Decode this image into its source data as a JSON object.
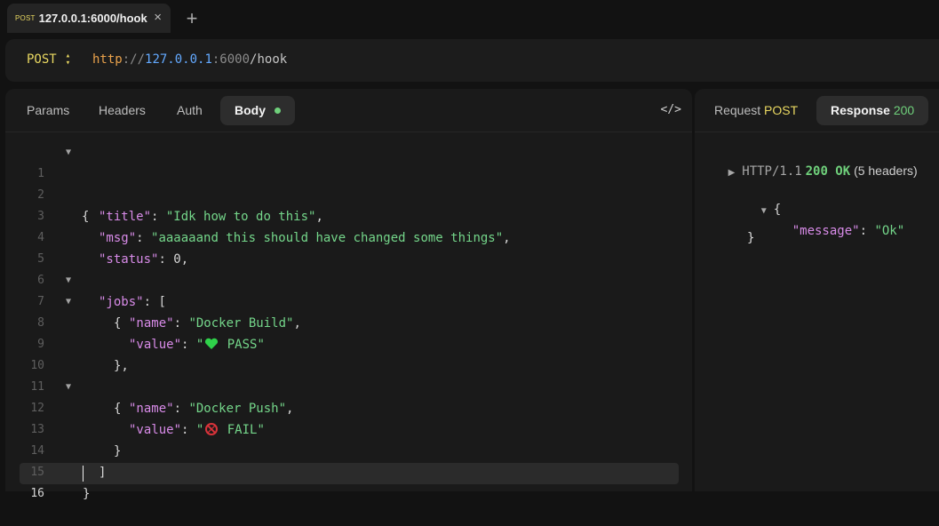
{
  "tab": {
    "method": "POST",
    "title": "127.0.0.1:6000/hook",
    "close": "×",
    "new_tab": "+"
  },
  "request": {
    "method": "POST",
    "method_toggle": "⬍",
    "url": {
      "scheme": "http",
      "sep": "://",
      "host": "127.0.0.1",
      "port": ":6000",
      "path": "/hook"
    }
  },
  "left_tabs": {
    "params": "Params",
    "headers": "Headers",
    "auth": "Auth",
    "body": "Body"
  },
  "code_toggle": "</>",
  "right_tabs": {
    "request_label": "Request",
    "request_method": "POST",
    "response_label": "Response",
    "response_code": "200"
  },
  "body_lines": {
    "l1": {
      "n": "1",
      "a": "{"
    },
    "l2": {
      "n": "2",
      "k": "\"title\"",
      "c": ": ",
      "s": "\"Idk how to do this\"",
      "e": ","
    },
    "l3": {
      "n": "3",
      "k": "\"msg\"",
      "c": ": ",
      "s": "\"aaaaaand this should have changed some things\"",
      "e": ","
    },
    "l4": {
      "n": "4",
      "k": "\"status\"",
      "c": ": ",
      "v": "0",
      "e": ","
    },
    "l5": {
      "n": "5",
      "k": "\"jobs\"",
      "c": ": ",
      "e": "["
    },
    "l6": {
      "n": "6",
      "a": "{"
    },
    "l7": {
      "n": "7",
      "k": "\"name\"",
      "c": ": ",
      "s": "\"Docker Build\"",
      "e": ","
    },
    "l8": {
      "n": "8",
      "k": "\"value\"",
      "c": ": ",
      "s1": "\"",
      "s2": " PASS\""
    },
    "l9": {
      "n": "9",
      "a": "},"
    },
    "l10": {
      "n": "10",
      "a": "{"
    },
    "l11": {
      "n": "11",
      "k": "\"name\"",
      "c": ": ",
      "s": "\"Docker Push\"",
      "e": ","
    },
    "l12": {
      "n": "12",
      "k": "\"value\"",
      "c": ": ",
      "s1": "\"",
      "s2": " FAIL\""
    },
    "l13": {
      "n": "13",
      "a": "}"
    },
    "l14": {
      "n": "14",
      "a": "]"
    },
    "l15": {
      "n": "15",
      "a": "}"
    },
    "l16": {
      "n": "16"
    }
  },
  "response": {
    "proto": "HTTP/1.1",
    "status": "200 OK",
    "headers_count": "(5 headers)",
    "open": "{",
    "key": "\"message\"",
    "colon": ": ",
    "value": "\"Ok\"",
    "close": "}"
  },
  "colors": {
    "accent_yellow": "#e9d861",
    "ok_green": "#6fd07b",
    "string_green": "#74d68a",
    "key_purple": "#d88be8",
    "host_blue": "#63a9ff",
    "scheme_orange": "#e8a14b"
  }
}
